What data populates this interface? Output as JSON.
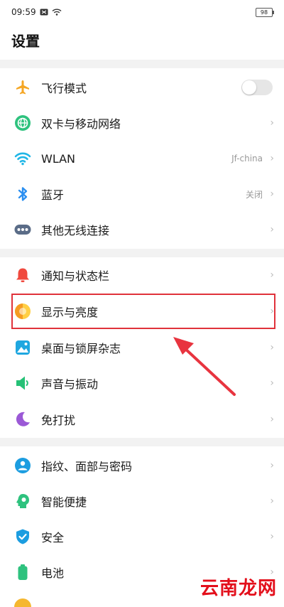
{
  "status_bar": {
    "time": "09:59",
    "battery": "98"
  },
  "header": {
    "title": "设置"
  },
  "sections": [
    {
      "items": [
        {
          "icon": "airplane-icon",
          "label": "飞行模式",
          "control": "toggle",
          "toggle_on": false
        },
        {
          "icon": "globe-network-icon",
          "label": "双卡与移动网络",
          "value": ""
        },
        {
          "icon": "wifi-icon",
          "label": "WLAN",
          "value": "Jf-china"
        },
        {
          "icon": "bluetooth-icon",
          "label": "蓝牙",
          "value": "关闭"
        },
        {
          "icon": "more-dots-icon",
          "label": "其他无线连接",
          "value": ""
        }
      ]
    },
    {
      "items": [
        {
          "icon": "bell-icon",
          "label": "通知与状态栏",
          "value": ""
        },
        {
          "icon": "display-brightness-icon",
          "label": "显示与亮度",
          "value": "",
          "highlighted": true
        },
        {
          "icon": "wallpaper-icon",
          "label": "桌面与锁屏杂志",
          "value": ""
        },
        {
          "icon": "speaker-icon",
          "label": "声音与振动",
          "value": ""
        },
        {
          "icon": "moon-icon",
          "label": "免打扰",
          "value": ""
        }
      ]
    },
    {
      "items": [
        {
          "icon": "fingerprint-face-icon",
          "label": "指纹、面部与密码",
          "value": ""
        },
        {
          "icon": "smart-assist-icon",
          "label": "智能便捷",
          "value": ""
        },
        {
          "icon": "shield-icon",
          "label": "安全",
          "value": ""
        },
        {
          "icon": "battery-icon",
          "label": "电池",
          "value": ""
        }
      ]
    }
  ],
  "watermark": "云南龙网",
  "colors": {
    "highlight": "#e0323b",
    "arrow": "#e8343f",
    "chevron": "#bbbbbb",
    "section_gap": "#f2f2f2"
  }
}
